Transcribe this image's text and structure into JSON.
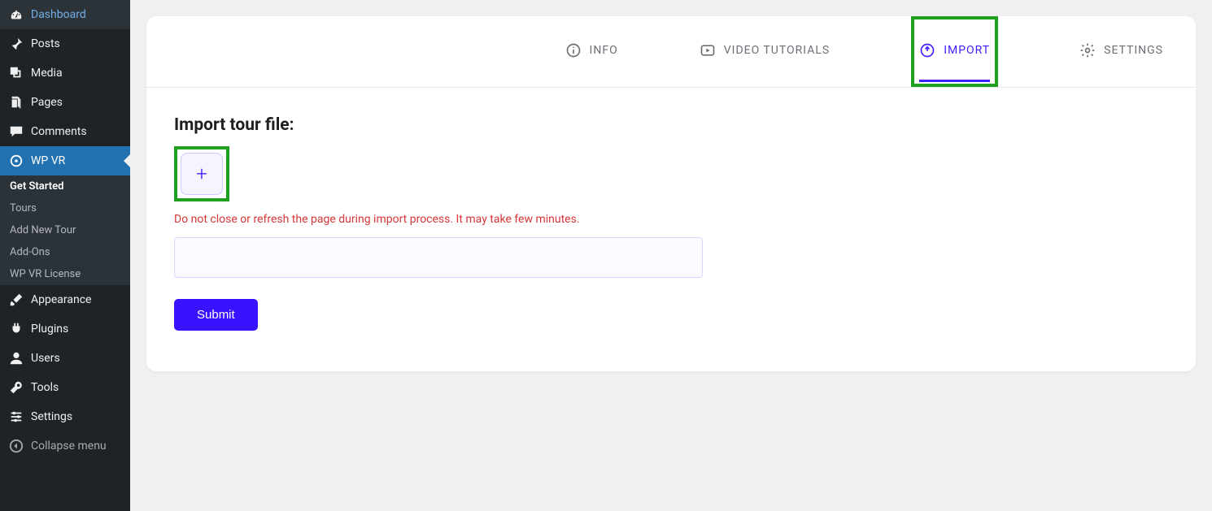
{
  "sidebar": {
    "items": [
      {
        "label": "Dashboard",
        "icon": "dashboard-icon"
      },
      {
        "label": "Posts",
        "icon": "pin-icon"
      },
      {
        "label": "Media",
        "icon": "media-icon"
      },
      {
        "label": "Pages",
        "icon": "pages-icon"
      },
      {
        "label": "Comments",
        "icon": "comment-icon"
      },
      {
        "label": "WP VR",
        "icon": "wpvr-icon",
        "active": true
      },
      {
        "label": "Appearance",
        "icon": "brush-icon"
      },
      {
        "label": "Plugins",
        "icon": "plug-icon"
      },
      {
        "label": "Users",
        "icon": "user-icon"
      },
      {
        "label": "Tools",
        "icon": "wrench-icon"
      },
      {
        "label": "Settings",
        "icon": "sliders-icon"
      }
    ],
    "sub": [
      {
        "label": "Get Started",
        "active": true
      },
      {
        "label": "Tours"
      },
      {
        "label": "Add New Tour"
      },
      {
        "label": "Add-Ons"
      },
      {
        "label": "WP VR License"
      }
    ],
    "collapse": "Collapse menu"
  },
  "tabs": [
    {
      "label": "INFO",
      "icon": "info-icon"
    },
    {
      "label": "VIDEO TUTORIALS",
      "icon": "play-icon"
    },
    {
      "label": "IMPORT",
      "icon": "import-icon",
      "active": true
    },
    {
      "label": "SETTINGS",
      "icon": "gear-icon"
    }
  ],
  "import": {
    "heading": "Import tour file:",
    "warning": "Do not close or refresh the page during import process. It may take few minutes.",
    "submit_label": "Submit"
  }
}
